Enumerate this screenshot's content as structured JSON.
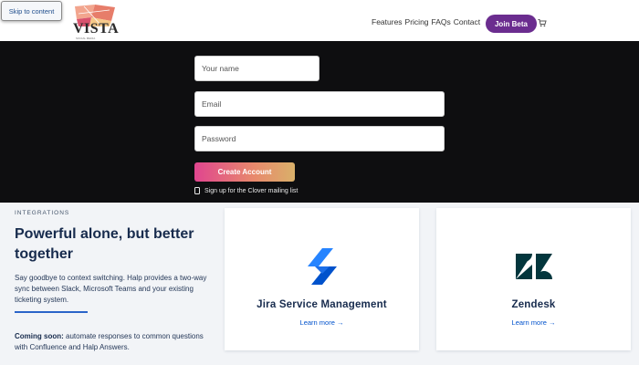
{
  "header": {
    "skip_link": "Skip to content",
    "logo": {
      "text": "VISTA",
      "sub": "SOCIAL MEDIA"
    },
    "nav": [
      "Features",
      "Pricing",
      "FAQs",
      "Contact"
    ],
    "join_button": "Join Beta",
    "cart_icon": "cart-icon"
  },
  "signup": {
    "name_placeholder": "Your name",
    "email_placeholder": "Email",
    "password_placeholder": "Password",
    "create_button": "Create Account",
    "mailing_label": "Sign up for the Clover mailing list"
  },
  "integrations": {
    "eyebrow": "INTEGRATIONS",
    "headline": "Powerful alone, but better together",
    "description": "Say goodbye to context switching. Halp provides a two-way sync between Slack, Microsoft Teams and your existing ticketing system.",
    "coming_soon_label": "Coming soon:",
    "coming_soon_text": "automate responses to common questions with Confluence and Halp Answers.",
    "cards": [
      {
        "title": "Jira Service Management",
        "link": "Learn more →",
        "icon": "jira-icon"
      },
      {
        "title": "Zendesk",
        "link": "Learn more →",
        "icon": "zendesk-icon"
      }
    ]
  },
  "colors": {
    "join_button": "#6b2d8f",
    "dark_band": "#0e0e10",
    "link_blue": "#0052cc",
    "heading_navy": "#172b4d",
    "jira_blue": "#2684ff",
    "zendesk_dark": "#03363d"
  }
}
